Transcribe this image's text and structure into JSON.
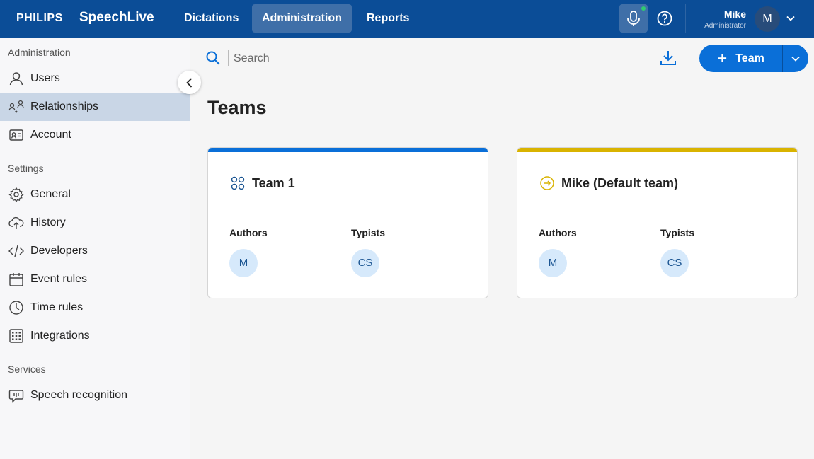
{
  "header": {
    "brand": "PHILIPS",
    "product": "SpeechLive",
    "nav": [
      {
        "label": "Dictations",
        "active": false
      },
      {
        "label": "Administration",
        "active": true
      },
      {
        "label": "Reports",
        "active": false
      }
    ],
    "user": {
      "name": "Mike",
      "role": "Administrator",
      "initial": "M"
    },
    "icons": {
      "mic": "microphone-icon",
      "help": "help-icon",
      "chevron": "chevron-down-icon"
    }
  },
  "sidebar": {
    "sections": [
      {
        "title": "Administration",
        "items": [
          {
            "label": "Users",
            "icon": "user-icon"
          },
          {
            "label": "Relationships",
            "icon": "relationships-icon",
            "active": true
          },
          {
            "label": "Account",
            "icon": "id-card-icon"
          }
        ]
      },
      {
        "title": "Settings",
        "items": [
          {
            "label": "General",
            "icon": "gear-icon"
          },
          {
            "label": "History",
            "icon": "cloud-upload-icon"
          },
          {
            "label": "Developers",
            "icon": "code-icon"
          },
          {
            "label": "Event rules",
            "icon": "calendar-icon"
          },
          {
            "label": "Time rules",
            "icon": "clock-icon"
          },
          {
            "label": "Integrations",
            "icon": "grid-icon"
          }
        ]
      },
      {
        "title": "Services",
        "items": [
          {
            "label": "Speech recognition",
            "icon": "speech-bubble-icon"
          }
        ]
      }
    ]
  },
  "toolbar": {
    "search_placeholder": "Search",
    "add_team_label": "Team",
    "add_team_icon": "plus-icon"
  },
  "page": {
    "title": "Teams"
  },
  "teams": [
    {
      "name": "Team 1",
      "icon": "team-circles-icon",
      "accent": "#0a6fd8",
      "authors_label": "Authors",
      "typists_label": "Typists",
      "authors": [
        "M"
      ],
      "typists": [
        "CS"
      ]
    },
    {
      "name": "Mike (Default team)",
      "icon": "arrow-circle-icon",
      "accent": "#d9b300",
      "authors_label": "Authors",
      "typists_label": "Typists",
      "authors": [
        "M"
      ],
      "typists": [
        "CS"
      ]
    }
  ],
  "colors": {
    "header_bg": "#0b4d97",
    "primary": "#0a6fd8",
    "sidebar_active": "#c9d6e6"
  }
}
